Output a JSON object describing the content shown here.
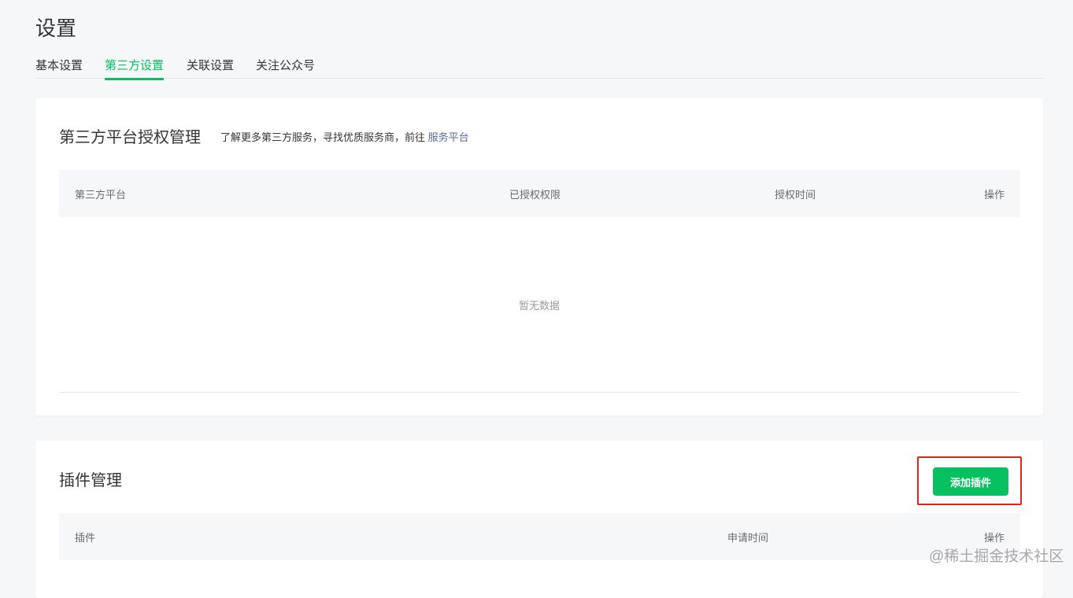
{
  "page_title": "设置",
  "tabs": [
    {
      "label": "基本设置"
    },
    {
      "label": "第三方设置",
      "active": true
    },
    {
      "label": "关联设置"
    },
    {
      "label": "关注公众号"
    }
  ],
  "auth": {
    "title": "第三方平台授权管理",
    "desc": "了解更多第三方服务，寻找优质服务商，前往",
    "link": "服务平台",
    "columns": [
      "第三方平台",
      "已授权权限",
      "授权时间",
      "操作"
    ],
    "empty": "暂无数据"
  },
  "plugins": {
    "title": "插件管理",
    "add_button": "添加插件",
    "columns": [
      "插件",
      "申请时间",
      "操作"
    ]
  },
  "watermark": "@稀土掘金技术社区",
  "colors": {
    "accent": "#07c160",
    "link": "#576b95",
    "highlight": "#e8231c"
  }
}
